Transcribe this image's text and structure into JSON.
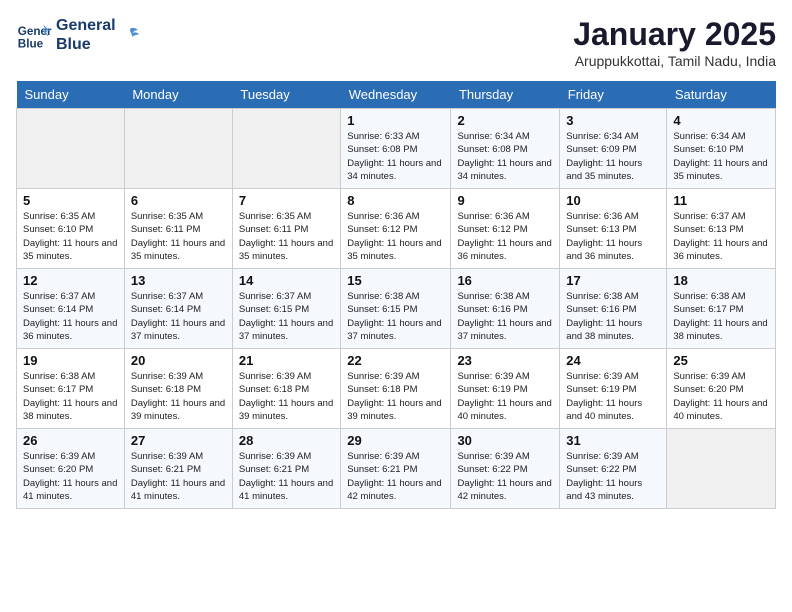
{
  "header": {
    "logo_line1": "General",
    "logo_line2": "Blue",
    "month_title": "January 2025",
    "location": "Aruppukkottai, Tamil Nadu, India"
  },
  "weekdays": [
    "Sunday",
    "Monday",
    "Tuesday",
    "Wednesday",
    "Thursday",
    "Friday",
    "Saturday"
  ],
  "weeks": [
    [
      {
        "day": "",
        "info": ""
      },
      {
        "day": "",
        "info": ""
      },
      {
        "day": "",
        "info": ""
      },
      {
        "day": "1",
        "info": "Sunrise: 6:33 AM\nSunset: 6:08 PM\nDaylight: 11 hours and 34 minutes."
      },
      {
        "day": "2",
        "info": "Sunrise: 6:34 AM\nSunset: 6:08 PM\nDaylight: 11 hours and 34 minutes."
      },
      {
        "day": "3",
        "info": "Sunrise: 6:34 AM\nSunset: 6:09 PM\nDaylight: 11 hours and 35 minutes."
      },
      {
        "day": "4",
        "info": "Sunrise: 6:34 AM\nSunset: 6:10 PM\nDaylight: 11 hours and 35 minutes."
      }
    ],
    [
      {
        "day": "5",
        "info": "Sunrise: 6:35 AM\nSunset: 6:10 PM\nDaylight: 11 hours and 35 minutes."
      },
      {
        "day": "6",
        "info": "Sunrise: 6:35 AM\nSunset: 6:11 PM\nDaylight: 11 hours and 35 minutes."
      },
      {
        "day": "7",
        "info": "Sunrise: 6:35 AM\nSunset: 6:11 PM\nDaylight: 11 hours and 35 minutes."
      },
      {
        "day": "8",
        "info": "Sunrise: 6:36 AM\nSunset: 6:12 PM\nDaylight: 11 hours and 35 minutes."
      },
      {
        "day": "9",
        "info": "Sunrise: 6:36 AM\nSunset: 6:12 PM\nDaylight: 11 hours and 36 minutes."
      },
      {
        "day": "10",
        "info": "Sunrise: 6:36 AM\nSunset: 6:13 PM\nDaylight: 11 hours and 36 minutes."
      },
      {
        "day": "11",
        "info": "Sunrise: 6:37 AM\nSunset: 6:13 PM\nDaylight: 11 hours and 36 minutes."
      }
    ],
    [
      {
        "day": "12",
        "info": "Sunrise: 6:37 AM\nSunset: 6:14 PM\nDaylight: 11 hours and 36 minutes."
      },
      {
        "day": "13",
        "info": "Sunrise: 6:37 AM\nSunset: 6:14 PM\nDaylight: 11 hours and 37 minutes."
      },
      {
        "day": "14",
        "info": "Sunrise: 6:37 AM\nSunset: 6:15 PM\nDaylight: 11 hours and 37 minutes."
      },
      {
        "day": "15",
        "info": "Sunrise: 6:38 AM\nSunset: 6:15 PM\nDaylight: 11 hours and 37 minutes."
      },
      {
        "day": "16",
        "info": "Sunrise: 6:38 AM\nSunset: 6:16 PM\nDaylight: 11 hours and 37 minutes."
      },
      {
        "day": "17",
        "info": "Sunrise: 6:38 AM\nSunset: 6:16 PM\nDaylight: 11 hours and 38 minutes."
      },
      {
        "day": "18",
        "info": "Sunrise: 6:38 AM\nSunset: 6:17 PM\nDaylight: 11 hours and 38 minutes."
      }
    ],
    [
      {
        "day": "19",
        "info": "Sunrise: 6:38 AM\nSunset: 6:17 PM\nDaylight: 11 hours and 38 minutes."
      },
      {
        "day": "20",
        "info": "Sunrise: 6:39 AM\nSunset: 6:18 PM\nDaylight: 11 hours and 39 minutes."
      },
      {
        "day": "21",
        "info": "Sunrise: 6:39 AM\nSunset: 6:18 PM\nDaylight: 11 hours and 39 minutes."
      },
      {
        "day": "22",
        "info": "Sunrise: 6:39 AM\nSunset: 6:18 PM\nDaylight: 11 hours and 39 minutes."
      },
      {
        "day": "23",
        "info": "Sunrise: 6:39 AM\nSunset: 6:19 PM\nDaylight: 11 hours and 40 minutes."
      },
      {
        "day": "24",
        "info": "Sunrise: 6:39 AM\nSunset: 6:19 PM\nDaylight: 11 hours and 40 minutes."
      },
      {
        "day": "25",
        "info": "Sunrise: 6:39 AM\nSunset: 6:20 PM\nDaylight: 11 hours and 40 minutes."
      }
    ],
    [
      {
        "day": "26",
        "info": "Sunrise: 6:39 AM\nSunset: 6:20 PM\nDaylight: 11 hours and 41 minutes."
      },
      {
        "day": "27",
        "info": "Sunrise: 6:39 AM\nSunset: 6:21 PM\nDaylight: 11 hours and 41 minutes."
      },
      {
        "day": "28",
        "info": "Sunrise: 6:39 AM\nSunset: 6:21 PM\nDaylight: 11 hours and 41 minutes."
      },
      {
        "day": "29",
        "info": "Sunrise: 6:39 AM\nSunset: 6:21 PM\nDaylight: 11 hours and 42 minutes."
      },
      {
        "day": "30",
        "info": "Sunrise: 6:39 AM\nSunset: 6:22 PM\nDaylight: 11 hours and 42 minutes."
      },
      {
        "day": "31",
        "info": "Sunrise: 6:39 AM\nSunset: 6:22 PM\nDaylight: 11 hours and 43 minutes."
      },
      {
        "day": "",
        "info": ""
      }
    ]
  ]
}
